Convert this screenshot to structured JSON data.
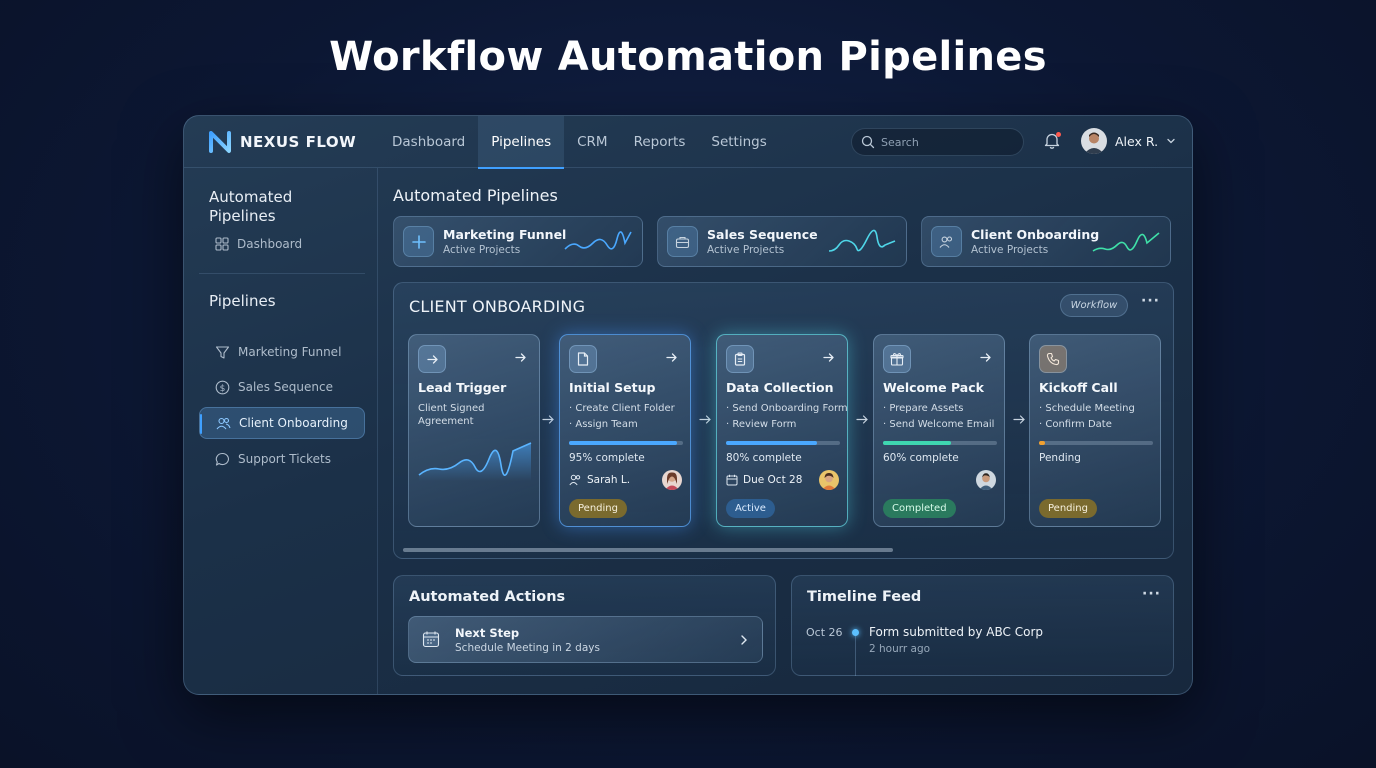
{
  "page_title": "Workflow Automation Pipelines",
  "app": {
    "logo_text": "NEXUS FLOW"
  },
  "nav": {
    "items": [
      {
        "label": "Dashboard",
        "active": false
      },
      {
        "label": "Pipelines",
        "active": true
      },
      {
        "label": "CRM",
        "active": false
      },
      {
        "label": "Reports",
        "active": false
      },
      {
        "label": "Settings",
        "active": false
      }
    ]
  },
  "search": {
    "placeholder": "Search"
  },
  "user": {
    "name": "Alex R."
  },
  "sidebar": {
    "heading_1": "Automated Pipelines",
    "dashboard_label": "Dashboard",
    "heading_2": "Pipelines",
    "items": [
      {
        "label": "Marketing Funnel",
        "icon": "funnel-icon",
        "active": false
      },
      {
        "label": "Sales Sequence",
        "icon": "dollar-icon",
        "active": false
      },
      {
        "label": "Client Onboarding",
        "icon": "users-icon",
        "active": true
      },
      {
        "label": "Support Tickets",
        "icon": "chat-icon",
        "active": false
      }
    ]
  },
  "main": {
    "title": "Automated Pipelines",
    "summaries": [
      {
        "title": "Marketing Funnel",
        "subtitle": "Active Projects",
        "icon": "plus-icon",
        "accent": "#4aa8ff"
      },
      {
        "title": "Sales Sequence",
        "subtitle": "Active Projects",
        "icon": "briefcase-icon",
        "accent": "#4fd6e8"
      },
      {
        "title": "Client Onboarding",
        "subtitle": "Active Projects",
        "icon": "users-icon",
        "accent": "#3fe0a8"
      }
    ]
  },
  "board": {
    "title": "CLIENT ONBOARDING",
    "chip": "Workflow",
    "stages": [
      {
        "name": "Lead Trigger",
        "lines": [
          "Client Signed",
          "Agreement"
        ],
        "icon": "arrow-right-icon"
      },
      {
        "name": "Initial Setup",
        "lines": [
          "· Create Client Folder",
          "· Assign Team"
        ],
        "icon": "document-icon",
        "progress": 0.95,
        "progress_text": "95% complete",
        "assignee": "Sarah L.",
        "status": "Pending",
        "status_color": "#7a6a2e",
        "bar_color": "#4aa8ff"
      },
      {
        "name": "Data Collection",
        "lines": [
          "· Send Onboarding Form",
          "· Review Form"
        ],
        "icon": "clipboard-icon",
        "progress": 0.8,
        "progress_text": "80% complete",
        "due": "Due Oct 28",
        "status": "Active",
        "status_color": "#2d5d8f",
        "bar_color": "#4aa8ff"
      },
      {
        "name": "Welcome Pack",
        "lines": [
          "· Prepare Assets",
          "· Send Welcome Email"
        ],
        "icon": "gift-icon",
        "progress": 0.6,
        "progress_text": "60% complete",
        "status": "Completed",
        "status_color": "#2a7a5e",
        "bar_color": "#3fd6b0"
      },
      {
        "name": "Kickoff Call",
        "lines": [
          "· Schedule Meeting",
          "· Confirm Date"
        ],
        "icon": "phone-icon",
        "progress": 0.05,
        "progress_text": "Pending",
        "status": "Pending",
        "status_color": "#7a6a2e",
        "bar_color": "#f0a030"
      }
    ]
  },
  "actions": {
    "title": "Automated Actions",
    "item_title": "Next Step",
    "item_sub": "Schedule Meeting in 2 days"
  },
  "timeline": {
    "title": "Timeline Feed",
    "date": "Oct 26",
    "text": "Form submitted by ABC Corp",
    "time": "2 hourr ago"
  }
}
